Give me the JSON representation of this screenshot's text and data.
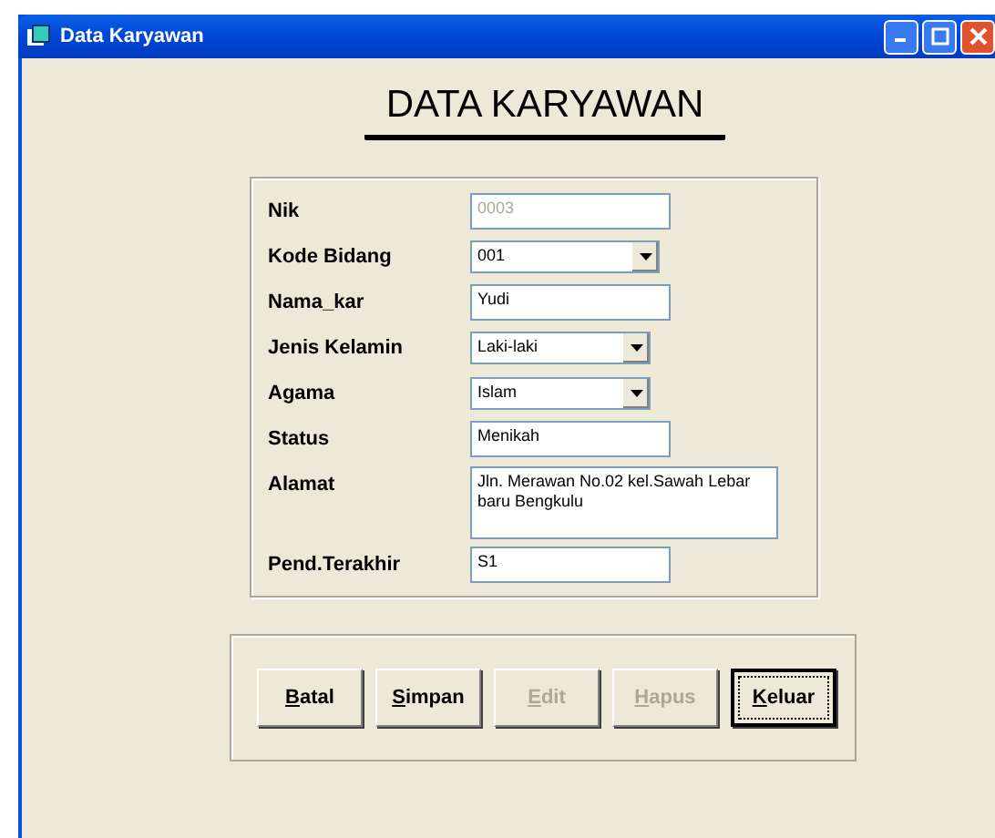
{
  "window": {
    "title": "Data Karyawan"
  },
  "heading": "DATA KARYAWAN",
  "fields": [
    {
      "label": "Nik",
      "kind": "text",
      "value": "0003",
      "disabled": true
    },
    {
      "label": "Kode Bidang",
      "kind": "combo",
      "value": "001",
      "disabled": false
    },
    {
      "label": "Nama_kar",
      "kind": "text",
      "value": "Yudi",
      "disabled": false
    },
    {
      "label": "Jenis Kelamin",
      "kind": "combo",
      "value": "Laki-laki",
      "disabled": false
    },
    {
      "label": "Agama",
      "kind": "combo",
      "value": "Islam",
      "disabled": false
    },
    {
      "label": "Status",
      "kind": "text",
      "value": "Menikah",
      "disabled": false
    },
    {
      "label": "Alamat",
      "kind": "memo",
      "value": "Jln. Merawan No.02 kel.Sawah Lebar baru Bengkulu",
      "disabled": false
    },
    {
      "label": "Pend.Terakhir",
      "kind": "text",
      "value": "S1",
      "disabled": false
    }
  ],
  "buttons": [
    {
      "mnemonic": "B",
      "rest": "atal",
      "disabled": false,
      "focused": false
    },
    {
      "mnemonic": "S",
      "rest": "impan",
      "disabled": false,
      "focused": false
    },
    {
      "mnemonic": "E",
      "rest": "dit",
      "disabled": true,
      "focused": false
    },
    {
      "mnemonic": "H",
      "rest": "apus",
      "disabled": true,
      "focused": false
    },
    {
      "mnemonic": "K",
      "rest": "eluar",
      "disabled": false,
      "focused": true
    }
  ]
}
